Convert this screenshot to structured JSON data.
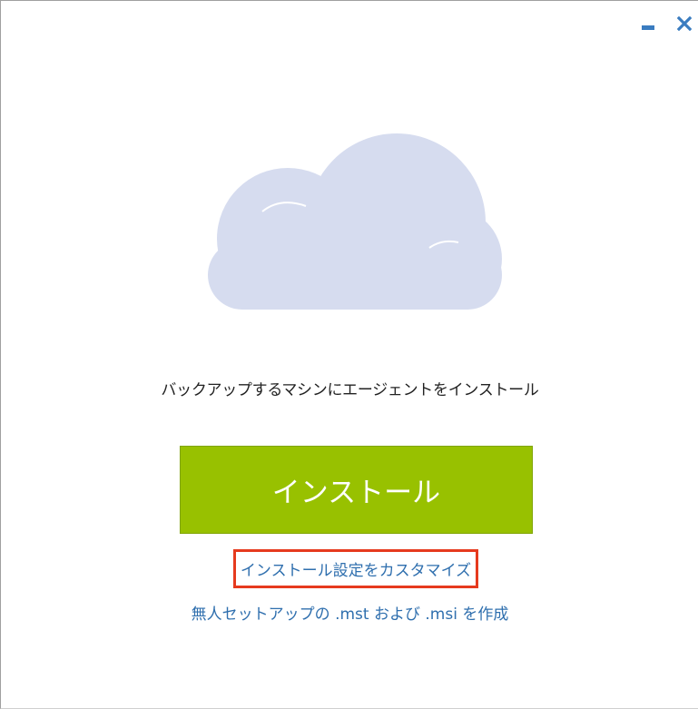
{
  "window": {
    "controls": {
      "minimize_icon": "minimize-icon",
      "close_icon": "close-icon",
      "accent_color": "#3a7cc0"
    }
  },
  "hero": {
    "icon": "cloud-icon",
    "cloud_color": "#d6dcef"
  },
  "main": {
    "subtitle": "バックアップするマシンにエージェントをインストール",
    "install_button_label": "インストール",
    "install_button_color": "#98c100",
    "customize_link": "インストール設定をカスタマイズ",
    "customize_highlight_color": "#e63a1e",
    "unattended_link": "無人セットアップの .mst および .msi を作成",
    "link_color": "#2f6fae"
  }
}
